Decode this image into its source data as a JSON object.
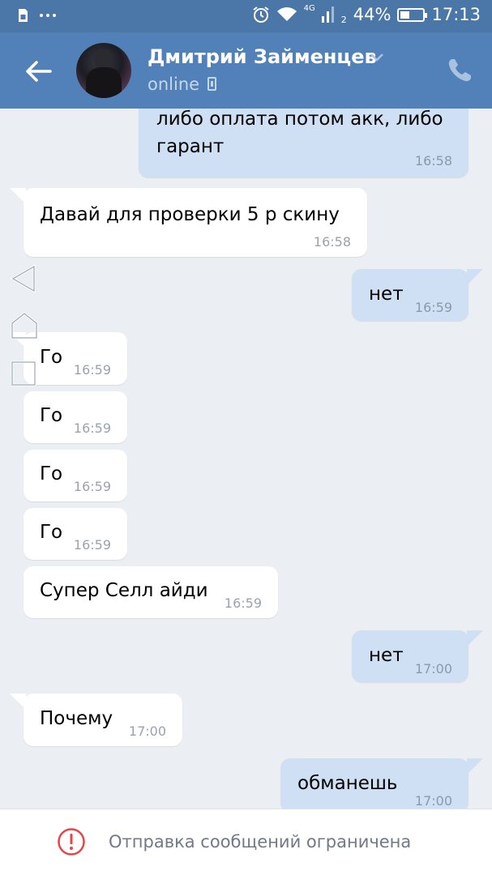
{
  "status_bar": {
    "time": "17:13",
    "battery": "44%",
    "battery_level": 0.44,
    "network": "4G",
    "sim": "2",
    "left_icons": [
      "sim-card-icon",
      "more-dots-icon"
    ],
    "right_icons": [
      "alarm-icon",
      "wifi-icon",
      "signal-icon",
      "battery-icon"
    ]
  },
  "header": {
    "contact_name": "Дмитрий Займенцев",
    "presence": "online",
    "back_icon": "arrow-left-icon",
    "call_icon": "phone-icon",
    "chevron_icon": "chevron-down-icon",
    "device_icon": "mobile-device-icon"
  },
  "messages": [
    {
      "dir": "out",
      "text": "либо оплата потом акк, либо\nгарант",
      "time": "16:58"
    },
    {
      "dir": "in",
      "text": "Давай для проверки 5 р скину",
      "time": "16:58"
    },
    {
      "dir": "out",
      "text": "нет",
      "time": "16:59"
    },
    {
      "dir": "in",
      "text": "Го",
      "time": "16:59"
    },
    {
      "dir": "in",
      "text": "Го",
      "time": "16:59"
    },
    {
      "dir": "in",
      "text": "Го",
      "time": "16:59"
    },
    {
      "dir": "in",
      "text": "Го",
      "time": "16:59"
    },
    {
      "dir": "in",
      "text": "Супер Селл айди",
      "time": "16:59"
    },
    {
      "dir": "out",
      "text": "нет",
      "time": "17:00"
    },
    {
      "dir": "in",
      "text": "Почему",
      "time": "17:00"
    },
    {
      "dir": "out",
      "text": "обманешь",
      "time": "17:00"
    }
  ],
  "overlay_nav": [
    "nav-back-icon",
    "nav-home-icon",
    "nav-recent-icon"
  ],
  "bottom": {
    "notice": "Отправка сообщений ограничена",
    "icon": "warning-circle-icon"
  },
  "colors": {
    "status_bar": "#4a76a8",
    "header": "#5181b8",
    "chat_bg": "#ebeef2",
    "incoming_bubble": "#ffffff",
    "outgoing_bubble": "#cfe0f4",
    "warning": "#e64646"
  }
}
